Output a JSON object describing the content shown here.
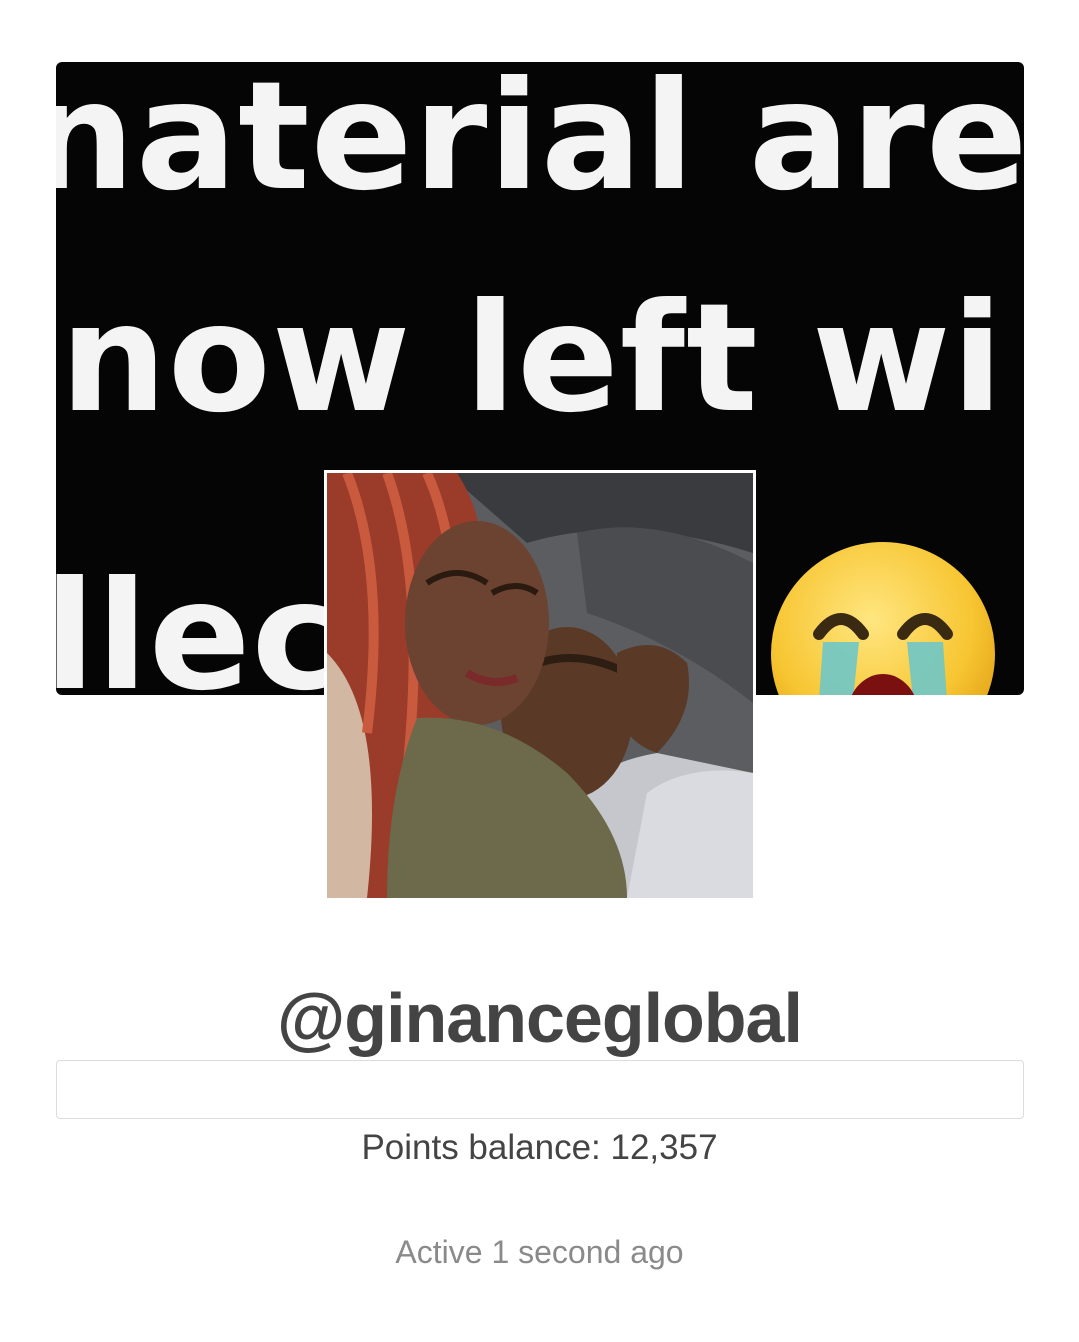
{
  "profile": {
    "cover_text": {
      "line1": "naterial are",
      "line2": "now left wi",
      "line3": "llec"
    },
    "cover_emoji": "crying-face-emoji",
    "avatar_icon": "profile-photo",
    "username": "@ginanceglobal",
    "bio": "",
    "points_label": "Points balance: 12,357",
    "last_active": "Active 1 second ago"
  },
  "colors": {
    "cover_background": "#050505",
    "cover_text": "#f4f4f4",
    "username_text": "#444444",
    "muted_text": "#8a8a8a",
    "border": "#dcdcdc"
  }
}
